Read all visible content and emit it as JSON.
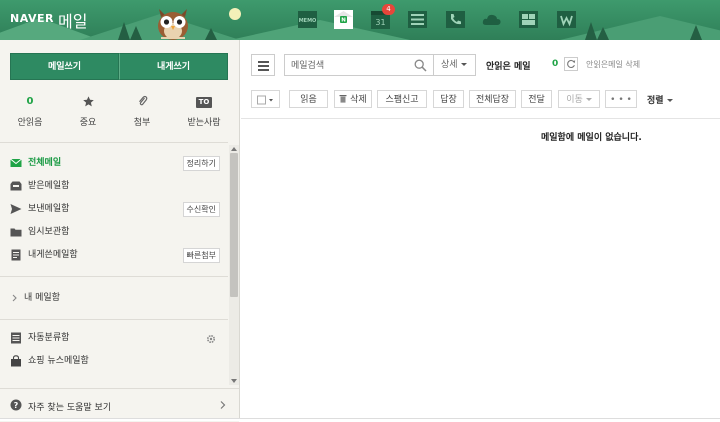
{
  "header": {
    "logo": "NAVER",
    "service": "메일",
    "apps": [
      {
        "name": "memo-icon",
        "label": "MEMO"
      },
      {
        "name": "mail-app-icon",
        "label": "N"
      },
      {
        "name": "calendar-icon",
        "label": "31",
        "badge": "4"
      },
      {
        "name": "contacts-icon"
      },
      {
        "name": "phone-icon"
      },
      {
        "name": "cloud-icon"
      },
      {
        "name": "office-icon"
      },
      {
        "name": "works-icon"
      }
    ],
    "colors": {
      "bar": "#2f7f58",
      "badge": "#e8463a"
    }
  },
  "sidebar": {
    "compose": {
      "write_label": "메일쓰기",
      "self_label": "내게쓰기"
    },
    "quick": [
      {
        "top": "0",
        "label": "안읽음"
      },
      {
        "top": "★",
        "label": "중요"
      },
      {
        "top": "📎",
        "label": "첨부"
      },
      {
        "top": "TO",
        "label": "받는사람"
      }
    ],
    "folders": [
      {
        "name": "전체메일",
        "action": "정리하기",
        "active": true
      },
      {
        "name": "받은메일함",
        "action": ""
      },
      {
        "name": "보낸메일함",
        "action": "수신확인"
      },
      {
        "name": "임시보관함",
        "action": ""
      },
      {
        "name": "내게쓴메일함",
        "action": "빠른첨부"
      }
    ],
    "my_mailbox": "내 메일함",
    "extra_folders": [
      {
        "name": "자동분류함"
      },
      {
        "name": "쇼핑 뉴스메일함"
      }
    ],
    "help": "자주 찾는 도움말 보기"
  },
  "main": {
    "search": {
      "placeholder": "메일검색",
      "detail": "상세"
    },
    "unread": {
      "label": "안읽은 메일",
      "count": "0",
      "delete": "안읽은메일 삭제"
    },
    "toolbar": {
      "read": "읽음",
      "delete": "삭제",
      "spam": "스팸신고",
      "reply": "답장",
      "reply_all": "전체답장",
      "forward": "전달",
      "move": "이동",
      "more": "• • •",
      "sort": "정렬"
    },
    "empty_message": "메일함에 메일이 없습니다."
  }
}
